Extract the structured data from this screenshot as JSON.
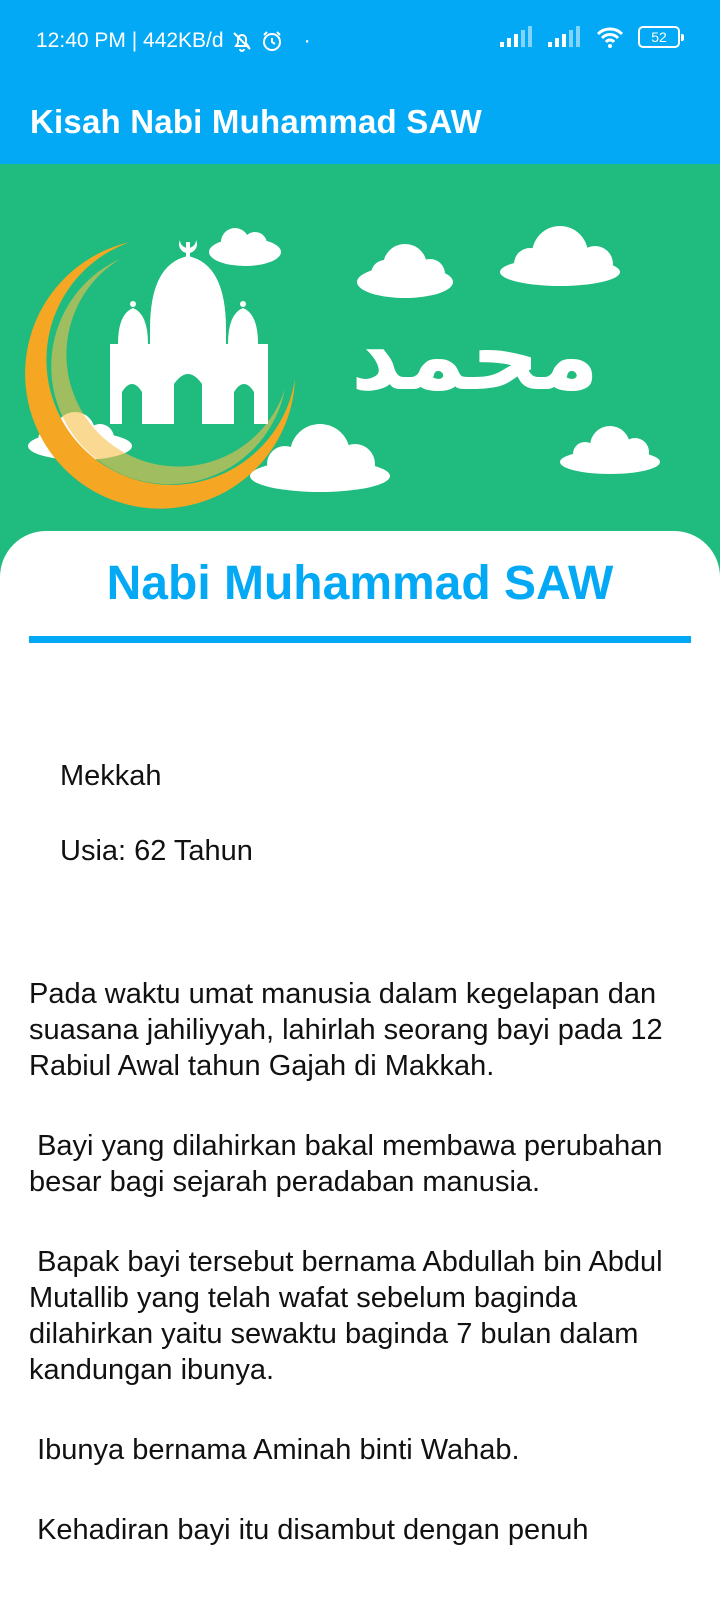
{
  "status_bar": {
    "time_speed": "12:40 PM | 442KB/d",
    "dot": "·",
    "battery": "52",
    "icons": [
      "bell-off-icon",
      "alarm-icon",
      "signal-icon",
      "signal-icon",
      "wifi-icon",
      "battery-icon"
    ]
  },
  "app_bar": {
    "title": "Kisah Nabi Muhammad SAW"
  },
  "banner": {
    "arabic_name": "محمد",
    "background_color": "#20bb7f",
    "illustrations": [
      "crescent-moon-icon",
      "mosque-icon",
      "cloud-icon"
    ]
  },
  "content": {
    "heading": "Nabi Muhammad SAW",
    "birthplace": "Mekkah",
    "age": "Usia: 62 Tahun",
    "paragraphs": [
      "Pada waktu umat manusia dalam kegelapan dan suasana jahiliyyah, lahirlah seorang bayi pada 12 Rabiul Awal tahun Gajah di Makkah.",
      " Bayi yang dilahirkan bakal membawa perubahan besar bagi sejarah peradaban manusia.",
      " Bapak bayi tersebut bernama Abdullah bin Abdul Mutallib yang telah wafat sebelum baginda dilahirkan yaitu sewaktu baginda 7 bulan dalam kandungan ibunya.",
      " Ibunya bernama Aminah binti Wahab.",
      " Kehadiran bayi itu disambut dengan penuh"
    ]
  },
  "colors": {
    "primary": "#03a9f4",
    "banner_green": "#20bb7f",
    "moon_orange": "#f5a623",
    "text": "#111111"
  }
}
